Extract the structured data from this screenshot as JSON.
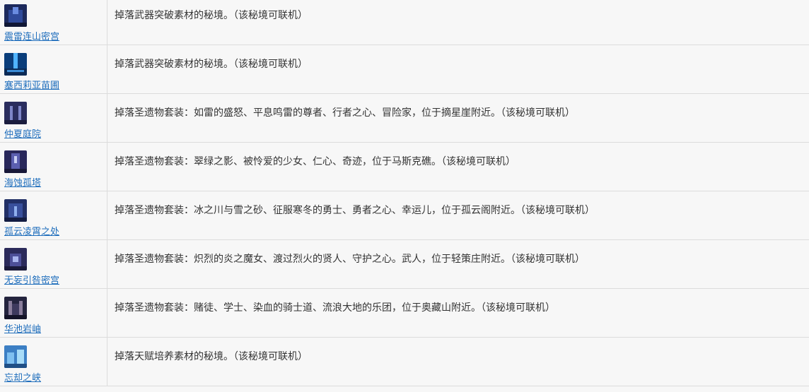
{
  "rows": [
    {
      "name": "震雷连山密宫",
      "desc": "掉落武器突破素材的秘境。（该秘境可联机）",
      "thumb_icon": "domain-thumbnail-icon"
    },
    {
      "name": "塞西莉亚苗圃",
      "desc": "掉落武器突破素材的秘境。（该秘境可联机）",
      "thumb_icon": "domain-thumbnail-icon"
    },
    {
      "name": "仲夏庭院",
      "desc": "掉落圣遗物套装：如雷的盛怒、平息鸣雷的尊者、行者之心、冒险家，位于摘星崖附近。（该秘境可联机）",
      "thumb_icon": "domain-thumbnail-icon"
    },
    {
      "name": "海蚀孤塔",
      "desc": "掉落圣遗物套装：翠绿之影、被怜爱的少女、仁心、奇迹，位于马斯克礁。（该秘境可联机）",
      "thumb_icon": "domain-thumbnail-icon"
    },
    {
      "name": "孤云凌霄之处",
      "desc": "掉落圣遗物套装：冰之川与雪之砂、征服寒冬的勇士、勇者之心、幸运儿，位于孤云阁附近。（该秘境可联机）",
      "thumb_icon": "domain-thumbnail-icon"
    },
    {
      "name": "无妄引咎密宫",
      "desc": "掉落圣遗物套装：炽烈的炎之魔女、渡过烈火的贤人、守护之心。武人，位于轻策庄附近。（该秘境可联机）",
      "thumb_icon": "domain-thumbnail-icon"
    },
    {
      "name": "华池岩岫",
      "desc": "掉落圣遗物套装：赌徒、学士、染血的骑士道、流浪大地的乐团，位于奥藏山附近。（该秘境可联机）",
      "thumb_icon": "domain-thumbnail-icon"
    },
    {
      "name": "忘却之峡",
      "desc": "掉落天赋培养素材的秘境。（该秘境可联机）",
      "thumb_icon": "domain-thumbnail-icon"
    }
  ],
  "colors": {
    "link": "#1f6ebc",
    "border": "#dcdcdc",
    "background": "#f7f7f7",
    "text": "#333333"
  }
}
